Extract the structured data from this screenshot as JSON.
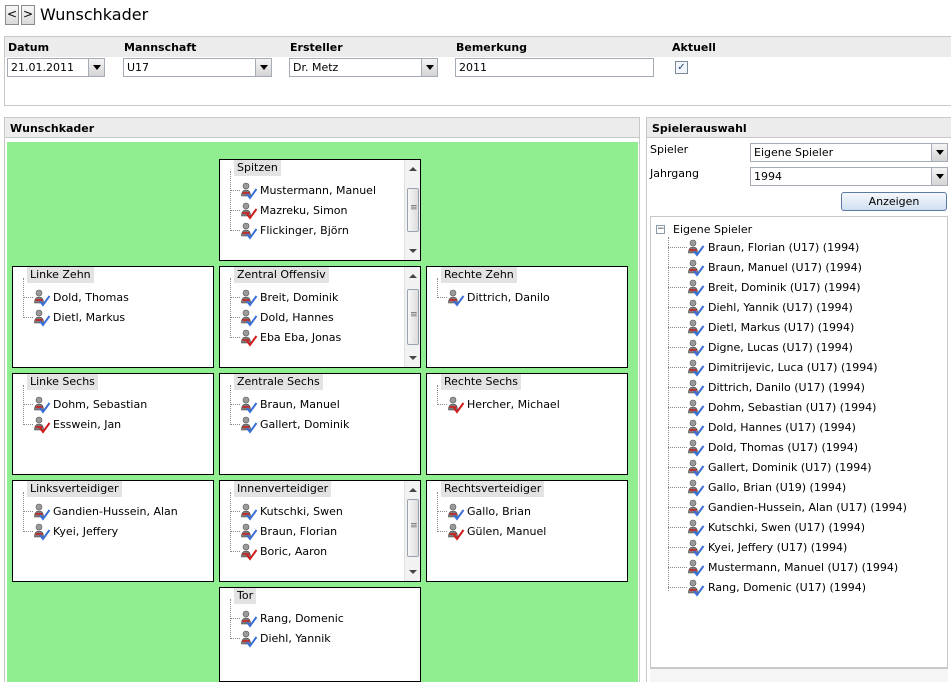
{
  "header": {
    "title": "Wunschkader",
    "back_label": "<",
    "forward_label": ">"
  },
  "filters": {
    "datum": {
      "label": "Datum",
      "value": "21.01.2011"
    },
    "mannschaft": {
      "label": "Mannschaft",
      "value": "U17"
    },
    "ersteller": {
      "label": "Ersteller",
      "value": "Dr. Metz"
    },
    "bemerkung": {
      "label": "Bemerkung",
      "value": "2011"
    },
    "aktuell": {
      "label": "Aktuell",
      "checked": true,
      "check_glyph": "✓"
    }
  },
  "wunschkader": {
    "title": "Wunschkader",
    "groups": {
      "spitzen": {
        "label": "Spitzen",
        "players": [
          {
            "name": "Mustermann, Manuel",
            "status": "blue"
          },
          {
            "name": "Mazreku, Simon",
            "status": "red"
          },
          {
            "name": "Flickinger, Björn",
            "status": "blue"
          }
        ]
      },
      "linke_zehn": {
        "label": "Linke Zehn",
        "players": [
          {
            "name": "Dold, Thomas",
            "status": "blue"
          },
          {
            "name": "Dietl, Markus",
            "status": "blue"
          }
        ]
      },
      "zentral_offensiv": {
        "label": "Zentral Offensiv",
        "players": [
          {
            "name": "Breit, Dominik",
            "status": "blue"
          },
          {
            "name": "Dold, Hannes",
            "status": "blue"
          },
          {
            "name": "Eba Eba, Jonas",
            "status": "red"
          }
        ]
      },
      "rechte_zehn": {
        "label": "Rechte Zehn",
        "players": [
          {
            "name": "Dittrich, Danilo",
            "status": "blue"
          }
        ]
      },
      "linke_sechs": {
        "label": "Linke Sechs",
        "players": [
          {
            "name": "Dohm, Sebastian",
            "status": "blue"
          },
          {
            "name": "Esswein, Jan",
            "status": "red"
          }
        ]
      },
      "zentrale_sechs": {
        "label": "Zentrale Sechs",
        "players": [
          {
            "name": "Braun, Manuel",
            "status": "blue"
          },
          {
            "name": "Gallert, Dominik",
            "status": "blue"
          }
        ]
      },
      "rechte_sechs": {
        "label": "Rechte Sechs",
        "players": [
          {
            "name": "Hercher, Michael",
            "status": "red"
          }
        ]
      },
      "linksverteidiger": {
        "label": "Linksverteidiger",
        "players": [
          {
            "name": "Gandien-Hussein, Alan",
            "status": "blue"
          },
          {
            "name": "Kyei, Jeffery",
            "status": "blue"
          }
        ]
      },
      "innenverteidiger": {
        "label": "Innenverteidiger",
        "players": [
          {
            "name": "Kutschki, Swen",
            "status": "blue"
          },
          {
            "name": "Braun, Florian",
            "status": "blue"
          },
          {
            "name": "Boric, Aaron",
            "status": "red"
          }
        ]
      },
      "rechtsverteidiger": {
        "label": "Rechtsverteidiger",
        "players": [
          {
            "name": "Gallo, Brian",
            "status": "blue"
          },
          {
            "name": "Gülen, Manuel",
            "status": "red"
          }
        ]
      },
      "tor": {
        "label": "Tor",
        "players": [
          {
            "name": "Rang, Domenic",
            "status": "blue"
          },
          {
            "name": "Diehl, Yannik",
            "status": "blue"
          }
        ]
      }
    }
  },
  "spielerauswahl": {
    "title": "Spielerauswahl",
    "spieler": {
      "label": "Spieler",
      "value": "Eigene Spieler"
    },
    "jahrgang": {
      "label": "Jahrgang",
      "value": "1994"
    },
    "button_label": "Anzeigen",
    "tree": {
      "root_label": "Eigene Spieler",
      "collapse_glyph": "−",
      "items": [
        "Braun, Florian (U17) (1994)",
        "Braun, Manuel (U17) (1994)",
        "Breit, Dominik (U17) (1994)",
        "Diehl, Yannik (U17) (1994)",
        "Dietl, Markus (U17) (1994)",
        "Digne, Lucas (U17) (1994)",
        "Dimitrijevic, Luca (U17) (1994)",
        "Dittrich, Danilo (U17) (1994)",
        "Dohm, Sebastian (U17) (1994)",
        "Dold, Hannes (U17) (1994)",
        "Dold, Thomas (U17) (1994)",
        "Gallert, Dominik (U17) (1994)",
        "Gallo, Brian (U19) (1994)",
        "Gandien-Hussein, Alan (U17) (1994)",
        "Kutschki, Swen (U17) (1994)",
        "Kyei, Jeffery (U17) (1994)",
        "Mustermann, Manuel (U17) (1994)",
        "Rang, Domenic (U17) (1994)"
      ]
    }
  },
  "colors": {
    "field_green": "#90ee90",
    "check_blue": "#3a6fd8",
    "check_red": "#d11a1a"
  }
}
